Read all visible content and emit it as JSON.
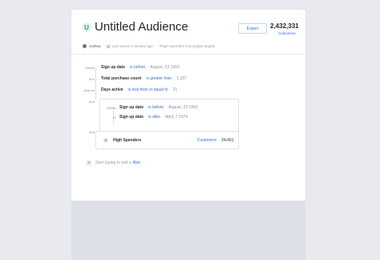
{
  "audience": {
    "badge": "U",
    "title": "Untitled Audience",
    "owner": "Joshua",
    "last_saved": "Last saved 2 minutes ago",
    "tags": "#high-spenders  #campaign-targets",
    "export_label": "Export",
    "count": "2,432,331",
    "count_label": "Customers"
  },
  "filters": [
    {
      "connector": "Where",
      "field": "Sign up date",
      "op": "is before",
      "value": "August, 23 1993"
    },
    {
      "connector": "And",
      "field": "Total purchase count",
      "op": "is greater than",
      "value": "1,337"
    },
    {
      "connector": "And/not",
      "field": "Days active",
      "op": "is less than or equal to",
      "value": "21"
    }
  ],
  "group": {
    "connector": "And",
    "rows": [
      {
        "connector": "Where",
        "field": "Sign up date",
        "op": "is before",
        "value": "August, 23 1993"
      },
      {
        "connector": "Or",
        "field": "Sign up date",
        "op": "is after",
        "value": "April, 7 1974"
      }
    ]
  },
  "segment": {
    "connector": "And",
    "icon_label": "H",
    "name": "High Spenders",
    "type": "Customers",
    "count": "24,401"
  },
  "add_filter": {
    "prefix": "Start typing to add a",
    "link": "filter"
  }
}
